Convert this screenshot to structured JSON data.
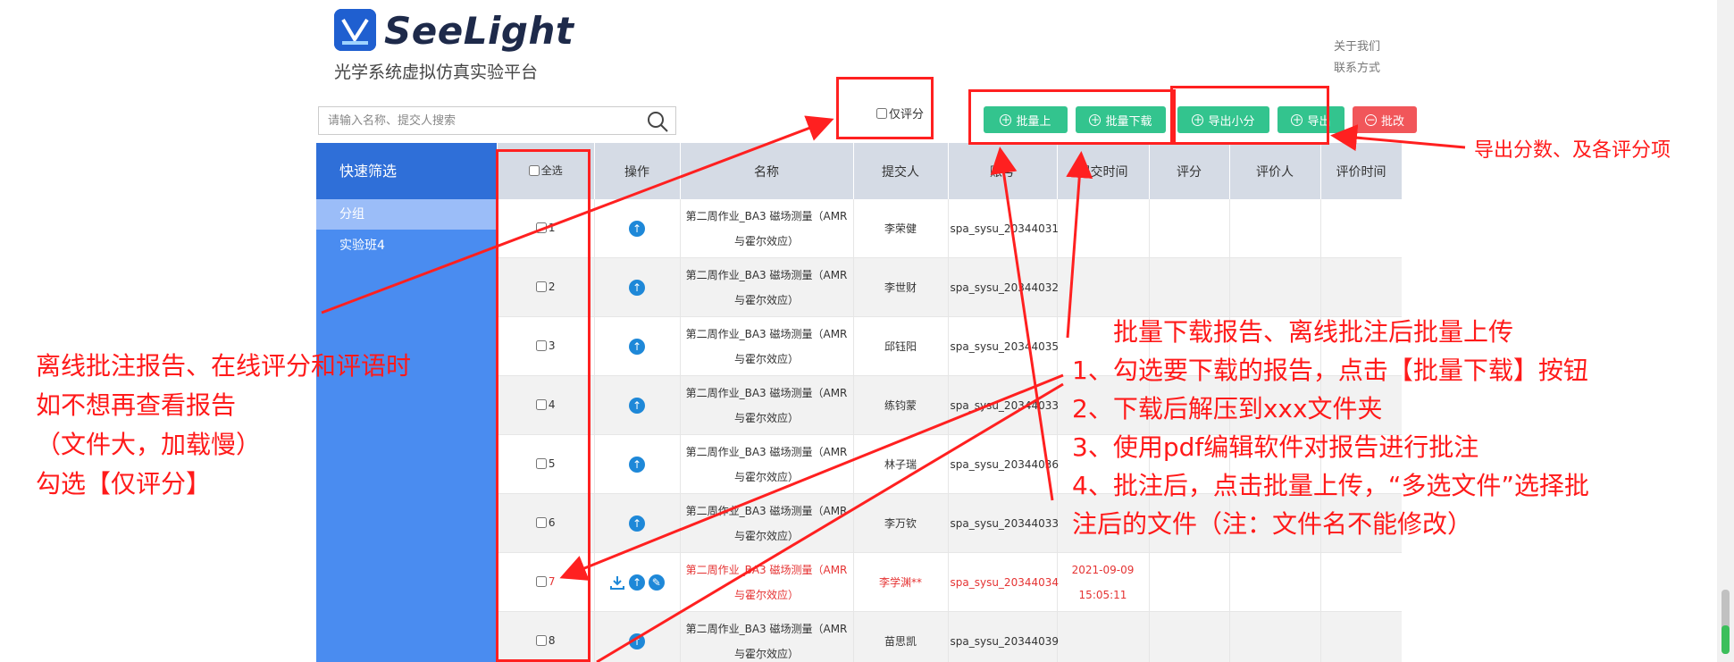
{
  "brand": {
    "name": "SeeLight",
    "subtitle": "光学系统虚拟仿真实验平台"
  },
  "top_links": [
    "关于我们",
    "联系方式"
  ],
  "search": {
    "placeholder": "请输入名称、提交人搜索"
  },
  "filter": {
    "score_only_label": "仅评分"
  },
  "toolbar": {
    "batch_upload": "批量上",
    "batch_download": "批量下载",
    "export_minor": "导出小分",
    "export": "导出",
    "batch_grade": "批改"
  },
  "sidebar": {
    "header": "快速筛选",
    "items": [
      {
        "label": "分组"
      },
      {
        "label": "实验班4"
      }
    ]
  },
  "table": {
    "select_all_label": "全选",
    "columns": [
      "操作",
      "名称",
      "提交人",
      "账号",
      "提交时间",
      "评分",
      "评价人",
      "评价时间"
    ],
    "rows": [
      {
        "num": "1",
        "name1": "第二周作业_BA3 磁场测量（AMR",
        "name2": "与霍尔效应）",
        "submitter": "李荣健",
        "account": "spa_sysu_20344031",
        "time1": "",
        "time2": ""
      },
      {
        "num": "2",
        "name1": "第二周作业_BA3 磁场测量（AMR",
        "name2": "与霍尔效应）",
        "submitter": "李世财",
        "account": "spa_sysu_20344032",
        "time1": "",
        "time2": ""
      },
      {
        "num": "3",
        "name1": "第二周作业_BA3 磁场测量（AMR",
        "name2": "与霍尔效应）",
        "submitter": "邱钰阳",
        "account": "spa_sysu_20344035",
        "time1": "",
        "time2": ""
      },
      {
        "num": "4",
        "name1": "第二周作业_BA3 磁场测量（AMR",
        "name2": "与霍尔效应）",
        "submitter": "练钧蒙",
        "account": "spa_sysu_20344033",
        "time1": "",
        "time2": ""
      },
      {
        "num": "5",
        "name1": "第二周作业_BA3 磁场测量（AMR",
        "name2": "与霍尔效应）",
        "submitter": "林子瑞",
        "account": "spa_sysu_20344036",
        "time1": "",
        "time2": ""
      },
      {
        "num": "6",
        "name1": "第二周作业_BA3 磁场测量（AMR",
        "name2": "与霍尔效应）",
        "submitter": "李万钦",
        "account": "spa_sysu_20344033",
        "time1": "",
        "time2": ""
      },
      {
        "num": "7",
        "name1": "第二周作业_BA3 磁场测量（AMR",
        "name2": "与霍尔效应）",
        "submitter": "李学渊**",
        "account": "spa_sysu_20344034",
        "time1": "2021-09-09",
        "time2": "15:05:11"
      },
      {
        "num": "8",
        "name1": "第二周作业_BA3 磁场测量（AMR",
        "name2": "与霍尔效应）",
        "submitter": "苗思凯",
        "account": "spa_sysu_20344039",
        "time1": "",
        "time2": ""
      }
    ]
  },
  "annotations": {
    "left_lines": [
      "离线批注报告、在线评分和评语时",
      "如不想再查看报告",
      "（文件大，加载慢）",
      "勾选【仅评分】"
    ],
    "right_top": "导出分数、及各评分项",
    "middle_lines": [
      "批量下载报告、离线批注后批量上传",
      "1、勾选要下载的报告，点击【批量下载】按钮",
      "2、下载后解压到xxx文件夹",
      "3、使用pdf编辑软件对报告进行批注",
      "4、批注后，点击批量上传，“多选文件”选择批",
      "注后的文件（注：文件名不能修改）"
    ]
  },
  "colors": {
    "accent": "#ff1a1a",
    "sidebar": "#4a8cf0",
    "button_green": "#33c48e",
    "button_red": "#f1565a"
  }
}
